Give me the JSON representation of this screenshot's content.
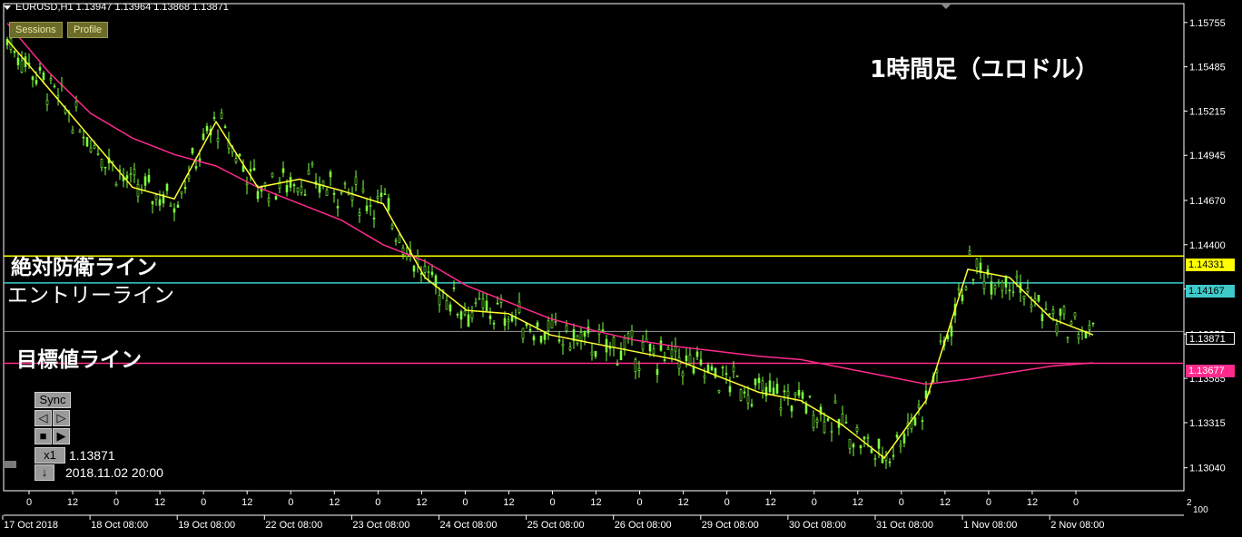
{
  "header": {
    "symbol_info": "EURUSD,H1  1.13947 1.13964 1.13868 1.13871"
  },
  "toolbar": {
    "sessions_label": "Sessions",
    "profile_label": "Profile"
  },
  "annotations": {
    "title": "1時間足（ユロドル）",
    "defense_line": "絶対防衛ライン",
    "entry_line": "エントリーライン",
    "target_line": "目標値ライン"
  },
  "price_axis": {
    "ticks": [
      "1.15755",
      "1.15485",
      "1.15215",
      "1.14945",
      "1.14670",
      "1.14400",
      "1.14130",
      "1.13855",
      "1.13585",
      "1.13315",
      "1.13040"
    ],
    "tags": {
      "defense": "1.14331",
      "entry": "1.14167",
      "current": "1.13871",
      "target": "1.13677"
    },
    "bottom_small": [
      "2",
      "100"
    ]
  },
  "time_axis": {
    "hours": [
      "0",
      "12",
      "0",
      "12",
      "0",
      "12",
      "0",
      "12",
      "0",
      "12",
      "0",
      "12",
      "0",
      "12",
      "0",
      "12",
      "0",
      "12",
      "0",
      "12",
      "0",
      "12",
      "0",
      "12",
      "0"
    ],
    "dates": [
      "17 Oct 2018",
      "18 Oct 08:00",
      "19 Oct 08:00",
      "22 Oct 08:00",
      "23 Oct 08:00",
      "24 Oct 08:00",
      "25 Oct 08:00",
      "26 Oct 08:00",
      "29 Oct 08:00",
      "30 Oct 08:00",
      "31 Oct 08:00",
      "1 Nov 08:00",
      "2 Nov 08:00"
    ]
  },
  "panel": {
    "sync_label": "Sync",
    "speed_label": "x1",
    "price_value": "1.13871",
    "datetime_value": "2018.11.02 20:00",
    "left_arrow": "◁",
    "right_arrow": "▷",
    "stop_symbol": "■",
    "play_symbol": "▶",
    "down_symbol": "↓"
  },
  "colors": {
    "background": "#000000",
    "candle": "#7fff3f",
    "ma_fast": "#ffff33",
    "ma_slow": "#ff2a8c",
    "defense_line": "#ffff00",
    "entry_line": "#3fc9c9",
    "target_line": "#ff2a8c",
    "current_line": "#9a9a9a",
    "grid_text": "#ffffff"
  },
  "chart_data": {
    "type": "line",
    "symbol": "EURUSD",
    "timeframe": "H1",
    "x": [
      "17 Oct 2018",
      "18 Oct 08:00",
      "19 Oct 08:00",
      "22 Oct 08:00",
      "23 Oct 08:00",
      "24 Oct 08:00",
      "25 Oct 08:00",
      "26 Oct 08:00",
      "29 Oct 08:00",
      "30 Oct 08:00",
      "31 Oct 08:00",
      "1 Nov 08:00",
      "2 Nov 08:00"
    ],
    "ylim": [
      1.129,
      1.1587
    ],
    "series": [
      {
        "values": [
          1.1565,
          1.1535,
          1.1505,
          1.1475,
          1.1468,
          1.1515,
          1.1475,
          1.148,
          1.1473,
          1.1465,
          1.142,
          1.14,
          1.1398,
          1.1385,
          1.138,
          1.1375,
          1.137,
          1.136,
          1.135,
          1.1345,
          1.133,
          1.131,
          1.1345,
          1.1425,
          1.142,
          1.1395,
          1.1385
        ]
      },
      {
        "values": [
          1.1575,
          1.1545,
          1.152,
          1.1505,
          1.1495,
          1.1488,
          1.1475,
          1.1465,
          1.1455,
          1.144,
          1.143,
          1.1415,
          1.1405,
          1.1395,
          1.1388,
          1.1382,
          1.1378,
          1.1375,
          1.1372,
          1.137,
          1.1365,
          1.136,
          1.1355,
          1.1358,
          1.1362,
          1.1366,
          1.1368
        ]
      }
    ],
    "horizontal_lines": [
      {
        "value": 1.14331
      },
      {
        "value": 1.14167
      },
      {
        "value": 1.13871
      },
      {
        "value": 1.13677
      }
    ]
  }
}
